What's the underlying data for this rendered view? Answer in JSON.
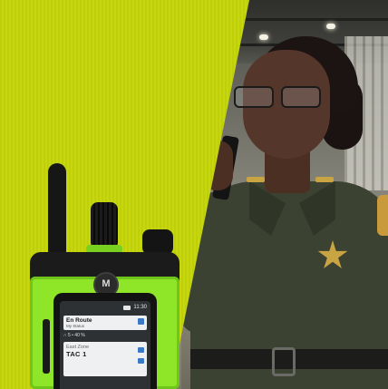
{
  "device": {
    "logo_glyph": "M",
    "time": "11:30",
    "status_card": {
      "title": "En Route",
      "subtitle": "My Status"
    },
    "signal_text": "∩ 5 • 40 %",
    "channel_card": {
      "zone": "East Zone",
      "channel": "TAC 1"
    }
  },
  "colors": {
    "panel_lime": "#c3d30c",
    "radio_green": "#8fe629",
    "uniform": "#3b4231",
    "badge_gold": "#c9a443"
  },
  "icons": [
    "battery-icon",
    "status-icon",
    "channel-icon",
    "emergency-icon"
  ]
}
